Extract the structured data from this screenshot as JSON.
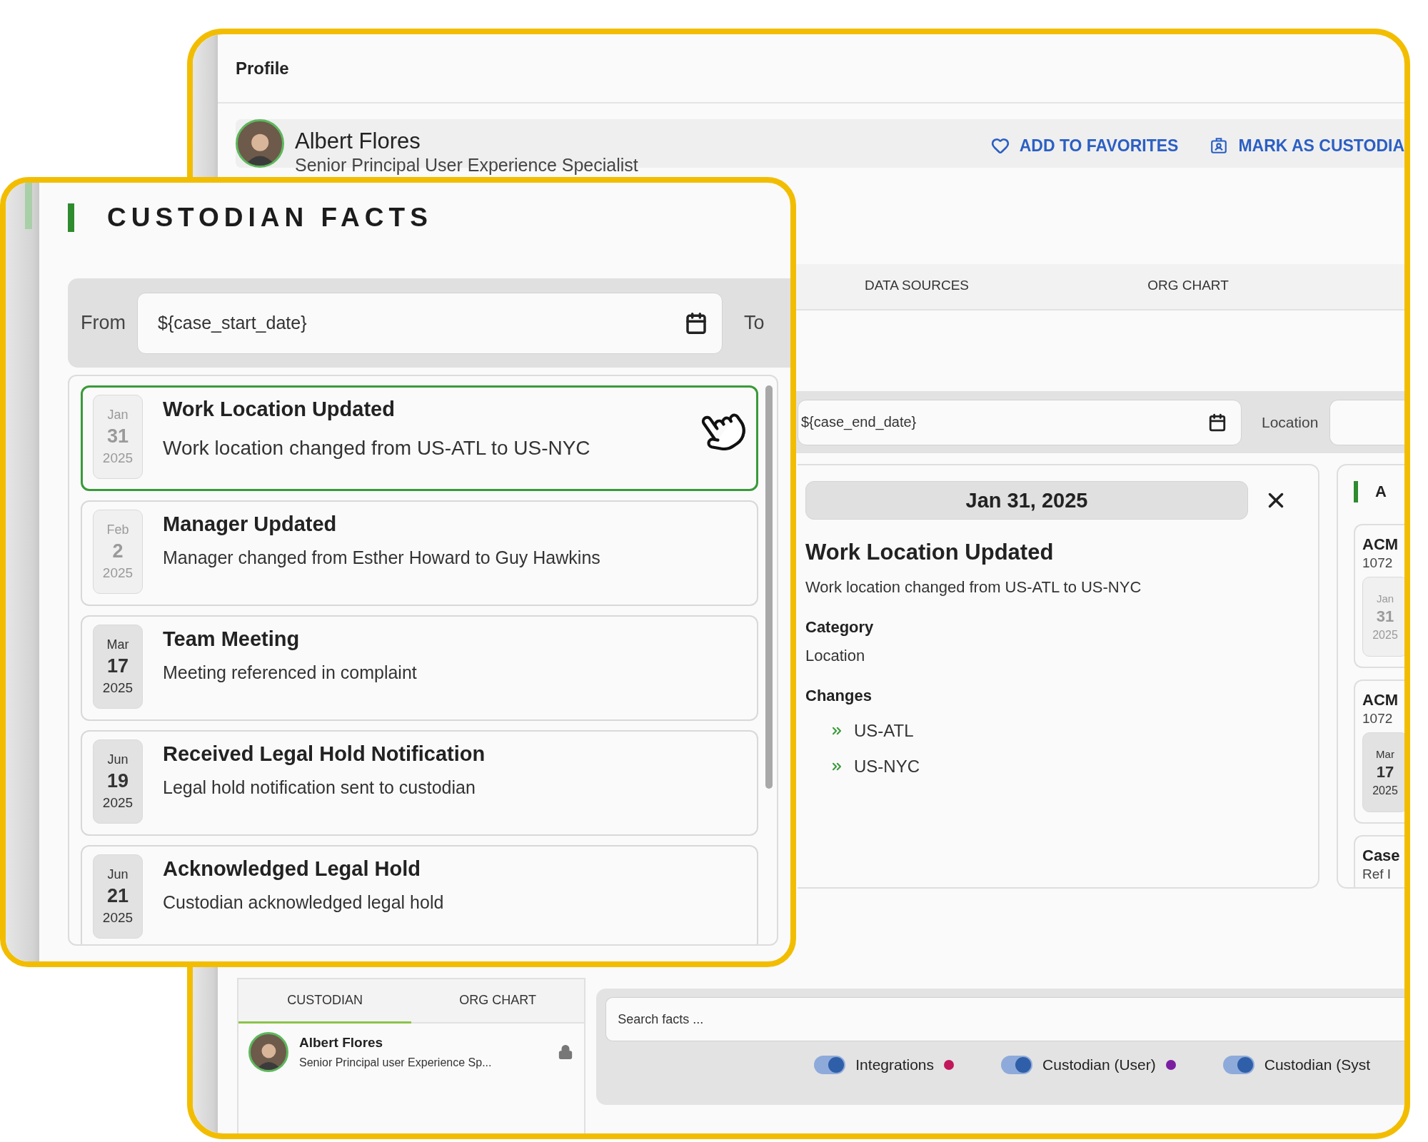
{
  "profile_header": {
    "title": "Profile"
  },
  "profile": {
    "name": "Albert Flores",
    "role": "Senior Principal User Experience Specialist",
    "actions": [
      {
        "kind": "heart",
        "label": "ADD TO FAVORITES"
      },
      {
        "kind": "badge",
        "label": "MARK AS CUSTODIA"
      }
    ]
  },
  "tabs": [
    {
      "label": "DATA SOURCES",
      "selected": false
    },
    {
      "label": "ORG CHART",
      "selected": false
    }
  ],
  "filters": {
    "end_date": "${case_end_date}",
    "location_label": "Location"
  },
  "detail": {
    "date": "Jan 31, 2025",
    "title": "Work Location Updated",
    "description": "Work location changed from US-ATL to US-NYC",
    "category_label": "Category",
    "category": "Location",
    "changes_label": "Changes",
    "changes": [
      "US-ATL",
      "US-NYC"
    ]
  },
  "side_panel": {
    "heading": "A",
    "cards": [
      {
        "title": "ACM",
        "ref": "1072",
        "month": "Jan",
        "day": "31",
        "year": "2025",
        "dimmed": true
      },
      {
        "title": "ACM",
        "ref": "1072",
        "month": "Mar",
        "day": "17",
        "year": "2025",
        "dimmed": false
      },
      {
        "title": "Case",
        "ref": "Ref I"
      }
    ]
  },
  "bottom": {
    "tabs": [
      {
        "label": "CUSTODIAN",
        "selected": true
      },
      {
        "label": "ORG CHART",
        "selected": false
      }
    ],
    "person": {
      "name": "Albert Flores",
      "role": "Senior Principal user Experience Sp...",
      "locked": true
    },
    "search": {
      "placeholder": "Search facts ..."
    },
    "sources": [
      {
        "label": "Integrations",
        "on": true,
        "color": "#c2185b"
      },
      {
        "label": "Custodian (User)",
        "on": true,
        "color": "#7b1fa2"
      },
      {
        "label": "Custodian (Syst",
        "on": true
      }
    ]
  },
  "facts_card": {
    "title": "CUSTODIAN FACTS",
    "from_label": "From",
    "from_date": "${case_start_date}",
    "to_label": "To",
    "facts": [
      {
        "month": "Jan",
        "day": "31",
        "year": "2025",
        "title": "Work Location Updated",
        "description": "Work location changed from US-ATL to US-NYC",
        "selected": true,
        "dimmed": true
      },
      {
        "month": "Feb",
        "day": "2",
        "year": "2025",
        "title": "Manager Updated",
        "description": "Manager changed from Esther Howard to Guy Hawkins",
        "selected": false,
        "dimmed": true
      },
      {
        "month": "Mar",
        "day": "17",
        "year": "2025",
        "title": "Team Meeting",
        "description": "Meeting referenced in complaint",
        "selected": false,
        "dimmed": false
      },
      {
        "month": "Jun",
        "day": "19",
        "year": "2025",
        "title": "Received Legal Hold Notification",
        "description": "Legal hold notification sent to custodian",
        "selected": false,
        "dimmed": false
      },
      {
        "month": "Jun",
        "day": "21",
        "year": "2025",
        "title": "Acknowledged Legal Hold",
        "description": "Custodian acknowledged legal hold",
        "selected": false,
        "dimmed": false
      }
    ]
  }
}
